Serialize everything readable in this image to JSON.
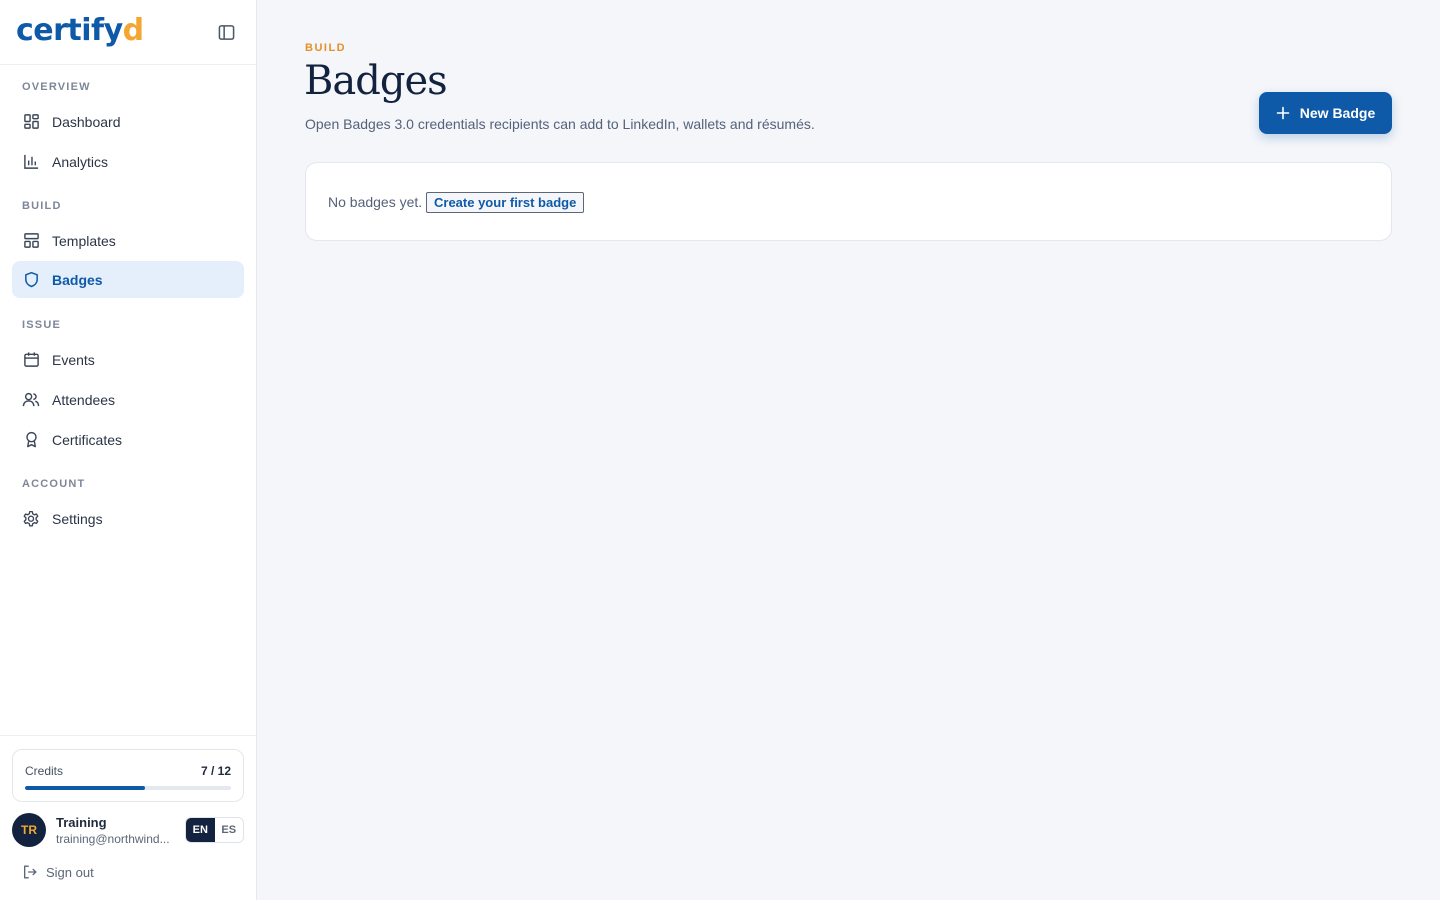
{
  "brand": {
    "logo_main": "certify",
    "logo_accent": "d"
  },
  "sidebar": {
    "sections": {
      "overview": "OVERVIEW",
      "build": "BUILD",
      "issue": "ISSUE",
      "account": "ACCOUNT"
    },
    "items": {
      "dashboard": "Dashboard",
      "analytics": "Analytics",
      "templates": "Templates",
      "badges": "Badges",
      "events": "Events",
      "attendees": "Attendees",
      "certificates": "Certificates",
      "settings": "Settings"
    },
    "active_item": "badges"
  },
  "credits": {
    "label": "Credits",
    "count": "7 / 12",
    "used": 7,
    "total": 12
  },
  "user": {
    "initials": "TR",
    "name": "Training",
    "email": "training@northwind..."
  },
  "language": {
    "options": [
      "EN",
      "ES"
    ],
    "selected": "EN"
  },
  "signout_label": "Sign out",
  "page": {
    "eyebrow": "BUILD",
    "title": "Badges",
    "subtitle": "Open Badges 3.0 credentials recipients can add to LinkedIn, wallets and résumés.",
    "new_button": "New Badge",
    "empty_text": "No badges yet.",
    "empty_link": "Create your first badge"
  },
  "colors": {
    "brand_blue": "#0f5aa8",
    "brand_orange": "#f3a632",
    "eyebrow_orange": "#e58f28",
    "active_bg": "#e5eefb",
    "navy": "#13233f"
  },
  "icons": {
    "collapse": "sidebar-toggle-icon",
    "dashboard": "grid-icon",
    "analytics": "bar-chart-icon",
    "templates": "layout-icon",
    "badges": "shield-icon",
    "events": "calendar-icon",
    "attendees": "users-icon",
    "certificates": "award-icon",
    "settings": "gear-icon",
    "signout": "log-out-icon",
    "new": "plus-icon"
  }
}
